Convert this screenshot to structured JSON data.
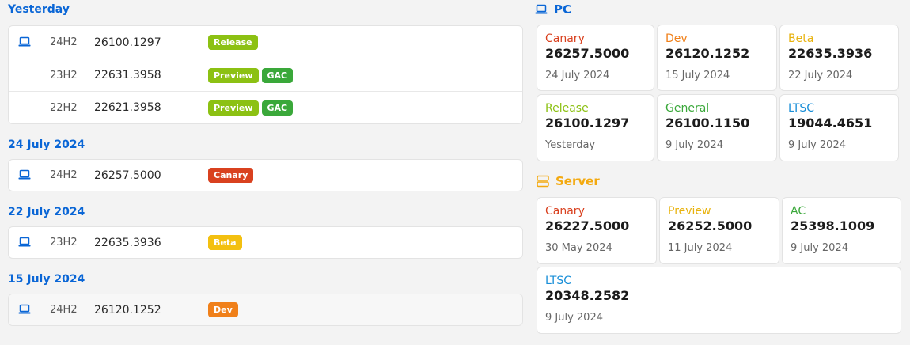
{
  "colors": {
    "accent": "#0a66d6",
    "server": "#f3a90f"
  },
  "groups": [
    {
      "title": "Yesterday",
      "rows": [
        {
          "icon": "laptop-icon",
          "version": "24H2",
          "build": "26100.1297",
          "badges": [
            "Release"
          ]
        },
        {
          "icon": "",
          "version": "23H2",
          "build": "22631.3958",
          "badges": [
            "Preview",
            "GAC"
          ]
        },
        {
          "icon": "",
          "version": "22H2",
          "build": "22621.3958",
          "badges": [
            "Preview",
            "GAC"
          ]
        }
      ]
    },
    {
      "title": "24 July 2024",
      "rows": [
        {
          "icon": "laptop-icon",
          "version": "24H2",
          "build": "26257.5000",
          "badges": [
            "Canary"
          ]
        }
      ]
    },
    {
      "title": "22 July 2024",
      "rows": [
        {
          "icon": "laptop-icon",
          "version": "23H2",
          "build": "22635.3936",
          "badges": [
            "Beta"
          ]
        }
      ]
    },
    {
      "title": "15 July 2024",
      "rows": [
        {
          "icon": "laptop-icon",
          "version": "24H2",
          "build": "26120.1252",
          "badges": [
            "Dev"
          ]
        }
      ]
    }
  ],
  "pc": {
    "title": "PC",
    "icon": "laptop-icon",
    "tiles": [
      {
        "name": "Canary",
        "build": "26257.5000",
        "date": "24 July 2024"
      },
      {
        "name": "Dev",
        "build": "26120.1252",
        "date": "15 July 2024"
      },
      {
        "name": "Beta",
        "build": "22635.3936",
        "date": "22 July 2024"
      },
      {
        "name": "Release",
        "build": "26100.1297",
        "date": "Yesterday"
      },
      {
        "name": "General",
        "build": "26100.1150",
        "date": "9 July 2024"
      },
      {
        "name": "LTSC",
        "build": "19044.4651",
        "date": "9 July 2024"
      }
    ]
  },
  "server": {
    "title": "Server",
    "icon": "server-icon",
    "tiles": [
      {
        "name": "Canary",
        "build": "26227.5000",
        "date": "30 May 2024"
      },
      {
        "name": "Preview",
        "build": "26252.5000",
        "date": "11 July 2024"
      },
      {
        "name": "AC",
        "build": "25398.1009",
        "date": "9 July 2024"
      },
      {
        "name": "LTSC",
        "build": "20348.2582",
        "date": "9 July 2024"
      }
    ]
  }
}
